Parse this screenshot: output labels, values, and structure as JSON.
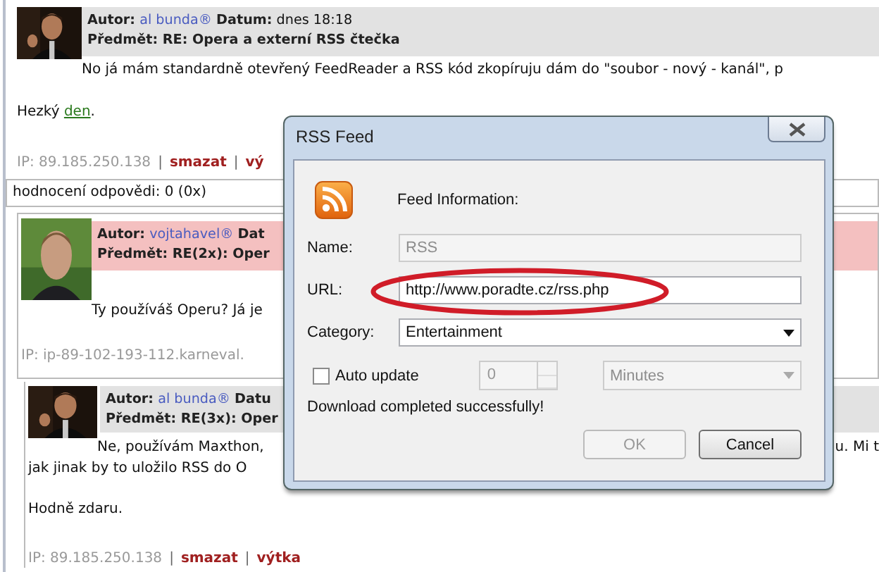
{
  "posts": [
    {
      "color": "#e2e2e2",
      "author_label": "Autor:",
      "author": "al bunda®",
      "date_label": "Datum:",
      "date": "dnes 18:18",
      "subject": "Předmět: RE: Opera a externí RSS čtečka",
      "lead": {
        "left": "No já mám standardně otevřený FeedReader a RSS kód zkopíruju dám do \"soubor - nový - kanál\", p"
      },
      "lines": [
        {
          "parts": [
            {
              "kind": "text",
              "text": "Hezký "
            },
            {
              "kind": "link",
              "text": "den"
            },
            {
              "kind": "text",
              "text": "."
            }
          ]
        }
      ],
      "ip": "IP: 89.185.250.138",
      "actions": [
        {
          "separator": "|",
          "label": "smazat"
        },
        {
          "separator": "|",
          "label": "vý"
        }
      ]
    },
    {
      "color": "#f4c0c0",
      "author_label": "Autor:",
      "author": "vojtahavel®",
      "date_label": "Dat",
      "subject": "Předmět: RE(2x): Oper",
      "lead": {
        "left": "Ty používáš Operu? Já je"
      },
      "ip": "IP: ip-89-102-193-112.karneval."
    },
    {
      "color": "#e2e2e2",
      "author_label": "Autor:",
      "author": "al bunda®",
      "date_label": "Datu",
      "subject": "Předmět: RE(3x): Oper",
      "lead": {
        "left": "Ne, používám Maxthon,",
        "right": "u. Mi t"
      },
      "lines": [
        {
          "parts": [
            {
              "kind": "text",
              "text": "jak jinak by to uložilo RSS do O"
            }
          ]
        },
        {
          "parts": [
            {
              "kind": "text",
              "text": "Hodně zdaru."
            }
          ]
        }
      ],
      "ip": "IP: 89.185.250.138",
      "actions": [
        {
          "separator": "|",
          "label": "smazat"
        },
        {
          "separator": "|",
          "label": "výtka"
        }
      ]
    }
  ],
  "rating": "hodnocení odpovědi: 0 (0x)",
  "dialog": {
    "title": "RSS Feed",
    "heading": "Feed Information:",
    "fields": [
      {
        "kind": "text",
        "label": "Name:",
        "value": "RSS",
        "disabled": true,
        "circled": false
      },
      {
        "kind": "text",
        "label": "URL:",
        "value": "http://www.poradte.cz/rss.php",
        "disabled": false,
        "circled": true
      },
      {
        "kind": "select",
        "label": "Category:",
        "value": "Entertainment",
        "disabled": false,
        "circled": false
      }
    ],
    "auto_update": {
      "label": "Auto update",
      "checked": false,
      "interval": "0",
      "unit": "Minutes",
      "disabled": true
    },
    "status": "Download completed successfully!",
    "buttons": [
      {
        "label": "OK",
        "disabled": true
      },
      {
        "label": "Cancel",
        "disabled": false
      }
    ]
  }
}
